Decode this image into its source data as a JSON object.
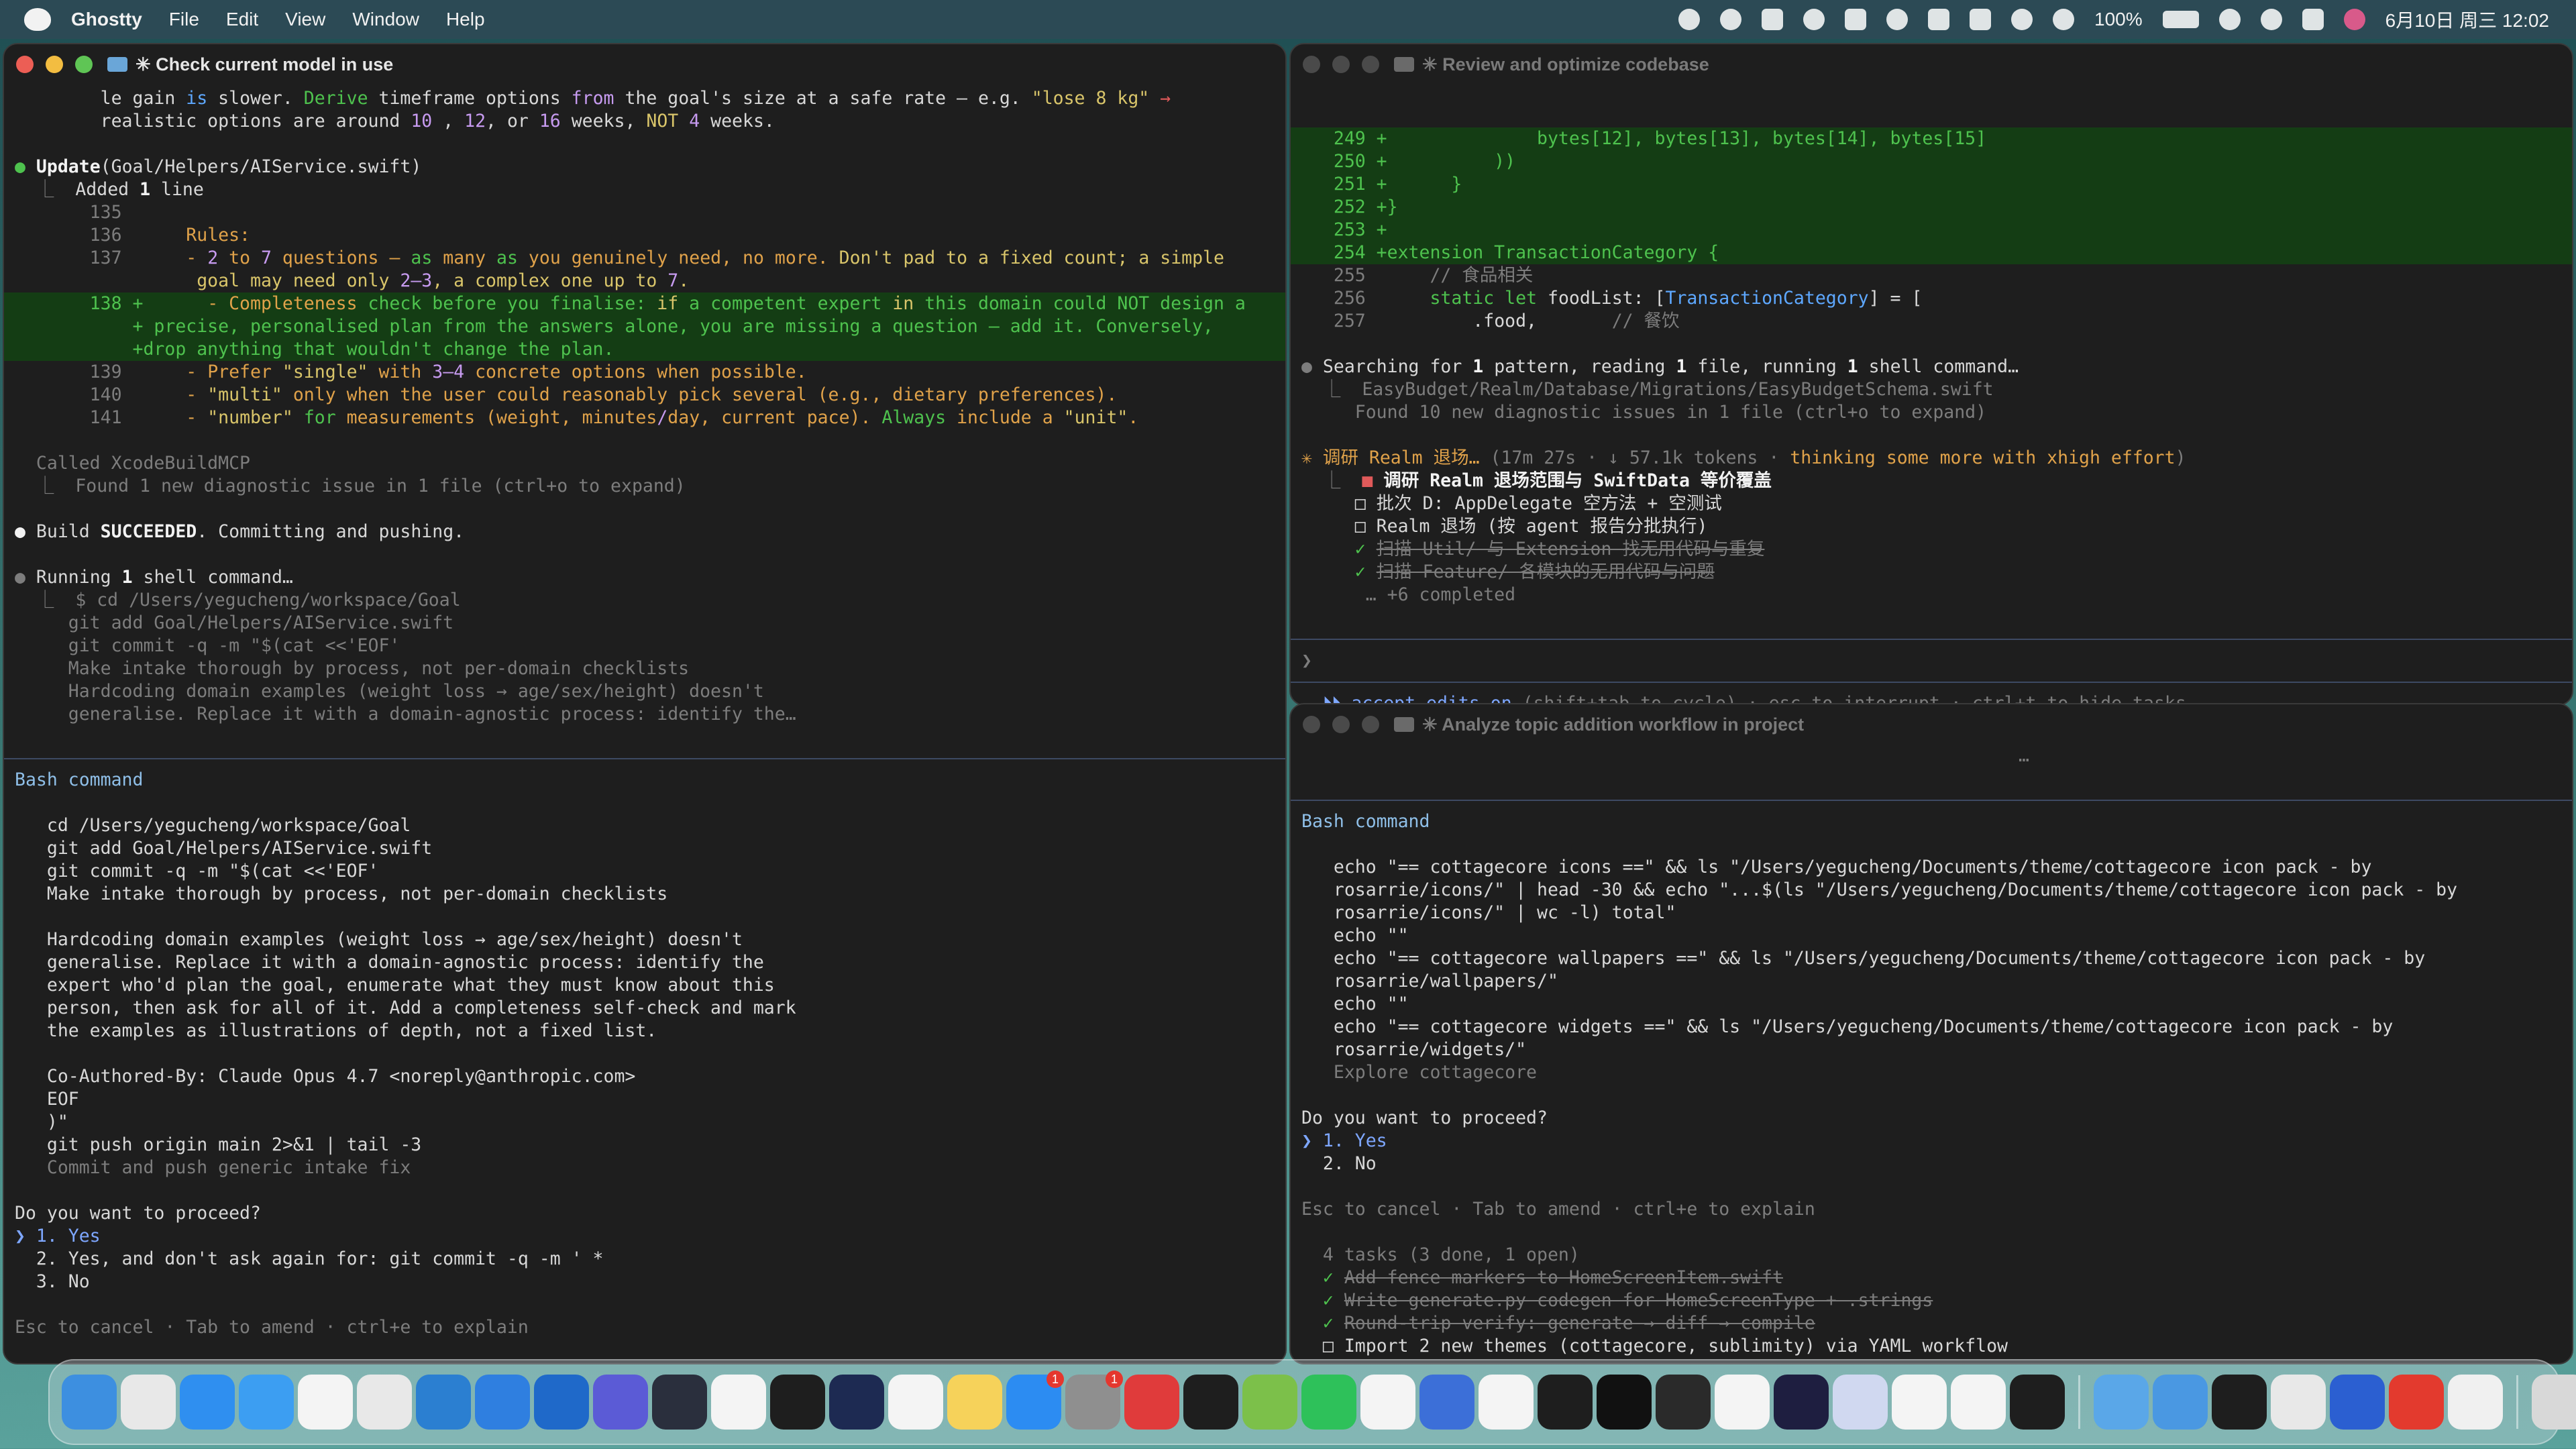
{
  "menubar": {
    "app_name": "Ghostty",
    "menus": [
      "File",
      "Edit",
      "View",
      "Window",
      "Help"
    ],
    "battery": "100%",
    "datetime": "6月10日 周三  12:02"
  },
  "left_window": {
    "title": "✳ Check current model in use",
    "lines": [
      [
        [
          "gr",
          "        "
        ],
        [
          "",
          "le gain "
        ],
        [
          "b",
          "is"
        ],
        [
          "",
          " slower. "
        ],
        [
          "g",
          "Derive"
        ],
        [
          "",
          " timeframe options "
        ],
        [
          "p",
          "from"
        ],
        [
          "",
          " the goal's size at a safe rate — e.g. "
        ],
        [
          "y",
          "\"lose 8 kg\""
        ],
        [
          "r",
          " →"
        ]
      ],
      [
        [
          "",
          "        realistic options are around "
        ],
        [
          "p",
          "10"
        ],
        [
          "",
          " , "
        ],
        [
          "p",
          "12"
        ],
        [
          "",
          ", or "
        ],
        [
          "p",
          "16"
        ],
        [
          "",
          " weeks, "
        ],
        [
          "y",
          "NOT"
        ],
        [
          "",
          " "
        ],
        [
          "p",
          "4"
        ],
        [
          "",
          " weeks."
        ]
      ],
      [
        [
          "",
          ""
        ]
      ],
      [
        [
          "g",
          "●"
        ],
        [
          "w",
          " Update"
        ],
        [
          "",
          "(Goal/Helpers/AIService.swift)"
        ]
      ],
      [
        [
          "gr",
          "  ⎿  "
        ],
        [
          "",
          "Added "
        ],
        [
          "w",
          "1"
        ],
        [
          "",
          " line"
        ]
      ],
      [
        [
          "gr",
          "       135"
        ]
      ],
      [
        [
          "gr",
          "       136      "
        ],
        [
          "o",
          "Rules:"
        ]
      ],
      [
        [
          "gr",
          "       137      "
        ],
        [
          "o",
          "- "
        ],
        [
          "p",
          "2"
        ],
        [
          "o",
          " to "
        ],
        [
          "p",
          "7"
        ],
        [
          "o",
          " questions — "
        ],
        [
          "g",
          "as"
        ],
        [
          "o",
          " many "
        ],
        [
          "g",
          "as"
        ],
        [
          "o",
          " you genuinely need, no more. "
        ],
        [
          "y",
          "Don't pad to a fixed count; a simple"
        ]
      ],
      [
        [
          "y",
          "                 goal may need only "
        ],
        [
          "p",
          "2–3"
        ],
        [
          "y",
          ", a complex one up to "
        ],
        [
          "p",
          "7"
        ],
        [
          "y",
          "."
        ]
      ]
    ],
    "diff_lines": [
      [
        [
          "g",
          "       138 +"
        ],
        [
          "",
          "      "
        ],
        [
          "o",
          "- Completeness"
        ],
        [
          "g",
          " check before you finalise: "
        ],
        [
          "y",
          "if"
        ],
        [
          "g",
          " a competent expert "
        ],
        [
          "y",
          "in"
        ],
        [
          "g",
          " this domain could NOT design a"
        ]
      ],
      [
        [
          "g",
          "           + precise, personalised plan from the answers alone, you are missing a question — add it. Conversely,"
        ]
      ],
      [
        [
          "g",
          "           +drop anything that wouldn't change the plan."
        ]
      ]
    ],
    "lines2": [
      [
        [
          "gr",
          "       139      "
        ],
        [
          "o",
          "- Prefer "
        ],
        [
          "y",
          "\"single\""
        ],
        [
          "o",
          " with "
        ],
        [
          "p",
          "3–4"
        ],
        [
          "o",
          " concrete options when possible."
        ]
      ],
      [
        [
          "gr",
          "       140      "
        ],
        [
          "o",
          "- "
        ],
        [
          "y",
          "\"multi\""
        ],
        [
          "o",
          " only when the user could reasonably pick several (e.g., dietary preferences)."
        ]
      ],
      [
        [
          "gr",
          "       141      "
        ],
        [
          "o",
          "- "
        ],
        [
          "y",
          "\"number\""
        ],
        [
          "o",
          " "
        ],
        [
          "g",
          "for"
        ],
        [
          "o",
          " measurements (weight, minutes"
        ],
        [
          "p",
          "/"
        ],
        [
          "o",
          "day, current pace). "
        ],
        [
          "g",
          "Always"
        ],
        [
          "o",
          " include a "
        ],
        [
          "y",
          "\"unit\""
        ],
        [
          "o",
          "."
        ]
      ],
      [
        [
          "",
          ""
        ]
      ],
      [
        [
          "gr",
          "  Called XcodeBuildMCP"
        ]
      ],
      [
        [
          "gr",
          "  ⎿  Found 1 new diagnostic issue in 1 file (ctrl+o to expand)"
        ]
      ],
      [
        [
          "",
          ""
        ]
      ],
      [
        [
          "w",
          "●"
        ],
        [
          "",
          " Build "
        ],
        [
          "w",
          "SUCCEEDED"
        ],
        [
          "",
          ". Committing and pushing."
        ]
      ],
      [
        [
          "",
          ""
        ]
      ],
      [
        [
          "gr",
          "●"
        ],
        [
          "",
          " Running "
        ],
        [
          "w",
          "1"
        ],
        [
          "",
          " shell command…"
        ]
      ],
      [
        [
          "gr",
          "  ⎿  $ cd /Users/yegucheng/workspace/Goal"
        ]
      ],
      [
        [
          "gr",
          "     git add Goal/Helpers/AIService.swift"
        ]
      ],
      [
        [
          "gr",
          "     git commit -q -m \"$(cat <<'EOF'"
        ]
      ],
      [
        [
          "gr",
          "     Make intake thorough by process, not per-domain checklists"
        ]
      ],
      [
        [
          "gr",
          "     Hardcoding domain examples (weight loss → age/sex/height) doesn't"
        ]
      ],
      [
        [
          "gr",
          "     generalise. Replace it with a domain-agnostic process: identify the…"
        ]
      ]
    ],
    "bash_header": "Bash command",
    "bash_lines": [
      "",
      "   cd /Users/yegucheng/workspace/Goal",
      "   git add Goal/Helpers/AIService.swift",
      "   git commit -q -m \"$(cat <<'EOF'",
      "   Make intake thorough by process, not per-domain checklists",
      "",
      "   Hardcoding domain examples (weight loss → age/sex/height) doesn't",
      "   generalise. Replace it with a domain-agnostic process: identify the",
      "   expert who'd plan the goal, enumerate what they must know about this",
      "   person, then ask for all of it. Add a completeness self-check and mark",
      "   the examples as illustrations of depth, not a fixed list.",
      "",
      "   Co-Authored-By: Claude Opus 4.7 <noreply@anthropic.com>",
      "   EOF",
      "   )\"",
      "   git push origin main 2>&1 | tail -3"
    ],
    "bash_desc": "   Commit and push generic intake fix",
    "prompt": "Do you want to proceed?",
    "options": [
      "❯ 1. Yes",
      "  2. Yes, and don't ask again for: git commit -q -m ' *",
      "  3. No"
    ],
    "footer": "Esc to cancel · Tab to amend · ctrl+e to explain"
  },
  "right_top_window": {
    "title": "✳ Review and optimize codebase",
    "diff_lines": [
      [
        "   249 +",
        "              bytes[12], bytes[13], bytes[14], bytes[15]"
      ],
      [
        "   250 +",
        "          ))"
      ],
      [
        "   251 +",
        "      }"
      ],
      [
        "   252 +",
        "}"
      ],
      [
        "   253 +",
        ""
      ],
      [
        "   254 +",
        "extension TransactionCategory {"
      ]
    ],
    "ctx_lines": [
      [
        [
          "gr",
          "   255      "
        ],
        [
          "gr",
          "// 食品相关"
        ]
      ],
      [
        [
          "gr",
          "   256      "
        ],
        [
          "g",
          "static"
        ],
        [
          "",
          " "
        ],
        [
          "g",
          "let"
        ],
        [
          "",
          " foodList: ["
        ],
        [
          "b",
          "TransactionCategory"
        ],
        [
          "",
          "] = ["
        ]
      ],
      [
        [
          "gr",
          "   257          "
        ],
        [
          "",
          ".food,"
        ],
        [
          "gr",
          "       // 餐饮"
        ]
      ],
      [
        [
          "",
          ""
        ]
      ],
      [
        [
          "gr",
          "●"
        ],
        [
          "",
          " Searching for "
        ],
        [
          "w",
          "1"
        ],
        [
          "",
          " pattern, reading "
        ],
        [
          "w",
          "1"
        ],
        [
          "",
          " file, running "
        ],
        [
          "w",
          "1"
        ],
        [
          "",
          " shell command…"
        ]
      ],
      [
        [
          "gr",
          "  ⎿  EasyBudget/Realm/Database/Migrations/EasyBudgetSchema.swift"
        ]
      ],
      [
        [
          "gr",
          "     Found "
        ],
        [
          "gr",
          "10"
        ],
        [
          "gr",
          " new diagnostic issues in 1 file (ctrl+o to expand)"
        ]
      ],
      [
        [
          "",
          ""
        ]
      ],
      [
        [
          "o",
          "✳ 调研 Realm 退场… "
        ],
        [
          "gr",
          "(17m 27s · ↓ 57.1k tokens · "
        ],
        [
          "o",
          "thinking some more with xhigh effort"
        ],
        [
          "gr",
          ")"
        ]
      ],
      [
        [
          "gr",
          "  ⎿  "
        ],
        [
          "r",
          "■"
        ],
        [
          "w",
          " 调研 Realm 退场范围与 SwiftData 等价覆盖"
        ]
      ],
      [
        [
          "",
          "     □ 批次 D: AppDelegate 空方法 + 空测试"
        ]
      ],
      [
        [
          "",
          "     □ Realm 退场 (按 agent 报告分批执行)"
        ]
      ]
    ],
    "done_items": [
      "扫描 Util/ 与 Extension 找无用代码与重复",
      "扫描 Feature/ 各模块的无用代码与问题"
    ],
    "more": "      … +6 completed",
    "prompt_char": "❯",
    "mode_line": [
      [
        "sel",
        "  ⏵⏵ accept edits on"
      ],
      [
        "gr",
        " (shift+tab to cycle) · esc to interrupt · ctrl+t to hide tasks"
      ]
    ]
  },
  "right_bottom_window": {
    "title": "✳ Analyze topic addition workflow in project",
    "ellipsis": "…",
    "bash_header": "Bash command",
    "bash_lines": [
      "",
      "   echo \"== cottagecore icons ==\" && ls \"/Users/yegucheng/Documents/theme/cottagecore icon pack - by",
      "   rosarrie/icons/\" | head -30 && echo \"...$(ls \"/Users/yegucheng/Documents/theme/cottagecore icon pack - by",
      "   rosarrie/icons/\" | wc -l) total\"",
      "   echo \"\"",
      "   echo \"== cottagecore wallpapers ==\" && ls \"/Users/yegucheng/Documents/theme/cottagecore icon pack - by",
      "   rosarrie/wallpapers/\"",
      "   echo \"\"",
      "   echo \"== cottagecore widgets ==\" && ls \"/Users/yegucheng/Documents/theme/cottagecore icon pack - by",
      "   rosarrie/widgets/\""
    ],
    "bash_desc": "   Explore cottagecore",
    "prompt": "Do you want to proceed?",
    "options": [
      "❯ 1. Yes",
      "  2. No"
    ],
    "footer": "Esc to cancel · Tab to amend · ctrl+e to explain",
    "tasks_header": "  4 tasks (3 done, 1 open)",
    "done_tasks": [
      "Add fence markers to HomeScreenItem.swift",
      "Write generate.py codegen for HomeScreenType + .strings",
      "Round-trip verify: generate → diff → compile"
    ],
    "open_task": "Import 2 new themes (cottagecore, sublimity) via YAML workflow"
  },
  "dock": {
    "apps": [
      {
        "name": "finder",
        "color": "#3d8fe0"
      },
      {
        "name": "launchpad",
        "color": "#e8e8e8"
      },
      {
        "name": "safari",
        "color": "#2f8ff0"
      },
      {
        "name": "mail",
        "color": "#3c9ef2"
      },
      {
        "name": "chatgpt",
        "color": "#f4f4f4"
      },
      {
        "name": "chrome",
        "color": "#e8e8e8"
      },
      {
        "name": "vscode",
        "color": "#2b7fd1"
      },
      {
        "name": "xcode",
        "color": "#2f7fe0"
      },
      {
        "name": "xcode-beta",
        "color": "#1f69c9"
      },
      {
        "name": "proxyman",
        "color": "#5b5bd6"
      },
      {
        "name": "ghostty",
        "color": "#2a2f3d"
      },
      {
        "name": "typora",
        "color": "#f4f4f4"
      },
      {
        "name": "figma",
        "color": "#1e1e1e"
      },
      {
        "name": "terminal",
        "color": "#1d2a52"
      },
      {
        "name": "reminders",
        "color": "#f4f4f4"
      },
      {
        "name": "notes",
        "color": "#f6d25a"
      },
      {
        "name": "app-store",
        "color": "#2c8cf2",
        "badge": "1"
      },
      {
        "name": "system-settings",
        "color": "#8f8f8f",
        "badge": "1"
      },
      {
        "name": "netease-music",
        "color": "#e03b3b"
      },
      {
        "name": "sim-app",
        "color": "#1e1e1e"
      },
      {
        "name": "android-studio",
        "color": "#7cc04a"
      },
      {
        "name": "wechat",
        "color": "#2ec15a"
      },
      {
        "name": "qqmusic",
        "color": "#f4f4f4"
      },
      {
        "name": "sequel",
        "color": "#3c6fd8"
      },
      {
        "name": "bluesky",
        "color": "#f4f4f4"
      },
      {
        "name": "claude-cli",
        "color": "#1e1e1e"
      },
      {
        "name": "capcut",
        "color": "#111111"
      },
      {
        "name": "raycast",
        "color": "#2a2a2a"
      },
      {
        "name": "windsurf",
        "color": "#f4f4f4"
      },
      {
        "name": "arc",
        "color": "#1e1e40"
      },
      {
        "name": "simulator",
        "color": "#d0d8f0"
      },
      {
        "name": "fork",
        "color": "#f4f4f4"
      },
      {
        "name": "chatbot",
        "color": "#f4f4f4"
      },
      {
        "name": "kindle",
        "color": "#1e1e1e"
      }
    ],
    "recent": [
      {
        "name": "folder-downloads",
        "color": "#5aa7e8"
      },
      {
        "name": "folder-cloud",
        "color": "#4a98e2"
      },
      {
        "name": "app-dark",
        "color": "#1e1e1e"
      },
      {
        "name": "app-light",
        "color": "#e8e8e8"
      },
      {
        "name": "app-blue",
        "color": "#2b5fd1"
      },
      {
        "name": "app-red",
        "color": "#e33a2e"
      },
      {
        "name": "app-doc",
        "color": "#f0f0f0"
      }
    ],
    "trash": {
      "name": "trash",
      "color": "#d8d8d8"
    }
  }
}
